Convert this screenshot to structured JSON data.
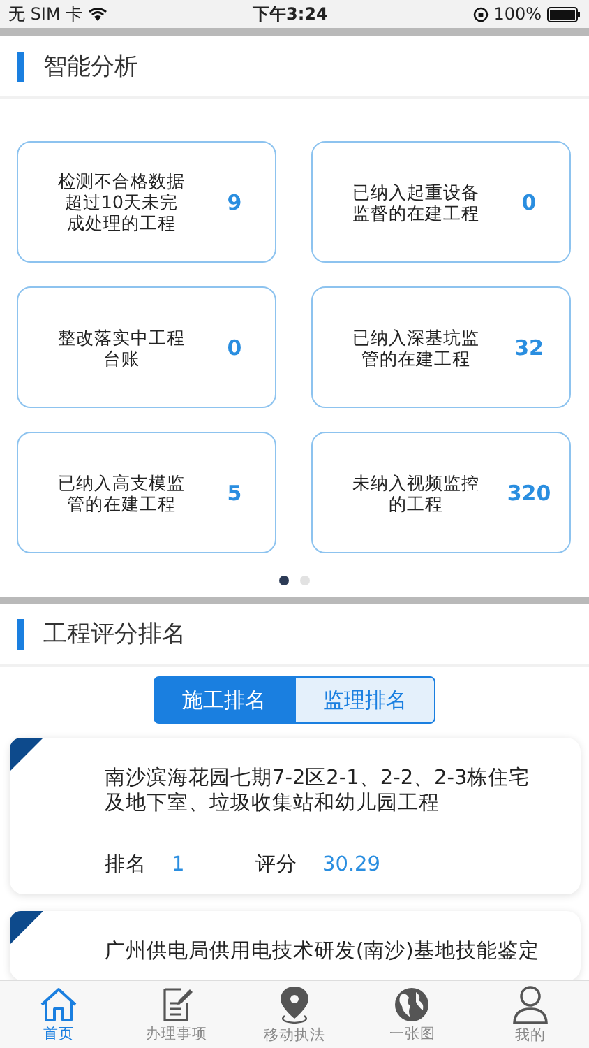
{
  "status_bar": {
    "carrier": "无 SIM 卡",
    "time": "下午3:24",
    "battery": "100%"
  },
  "analysis": {
    "title": "智能分析",
    "cards": [
      {
        "label": "检测不合格数据超过10天未完成处理的工程",
        "value": "9"
      },
      {
        "label": "已纳入起重设备监督的在建工程",
        "value": "0"
      },
      {
        "label": "整改落实中工程台账",
        "value": "0"
      },
      {
        "label": "已纳入深基坑监管的在建工程",
        "value": "32"
      },
      {
        "label": "已纳入高支模监管的在建工程",
        "value": "5"
      },
      {
        "label": "未纳入视频监控的工程",
        "value": "320"
      }
    ],
    "pages": [
      {
        "selected": true
      },
      {
        "selected": false
      }
    ]
  },
  "ranking": {
    "title": "工程评分排名",
    "tabs": [
      {
        "label": "施工排名",
        "selected": true
      },
      {
        "label": "监理排名",
        "selected": false
      }
    ],
    "items": [
      {
        "name": "南沙滨海花园七期7-2区2-1、2-2、2-3栋住宅及地下室、垃圾收集站和幼儿园工程",
        "rank_label": "排名",
        "rank": "1",
        "score_label": "评分",
        "score": "30.29"
      },
      {
        "name": "广州供电局供用电技术研发(南沙)基地技能鉴定"
      }
    ]
  },
  "tab_bar": [
    {
      "label": "首页",
      "kind": "home",
      "selected": true
    },
    {
      "label": "办理事项",
      "kind": "doc",
      "selected": false
    },
    {
      "label": "移动执法",
      "kind": "pin",
      "selected": false
    },
    {
      "label": "一张图",
      "kind": "globe",
      "selected": false
    },
    {
      "label": "我的",
      "kind": "user",
      "selected": false
    }
  ]
}
